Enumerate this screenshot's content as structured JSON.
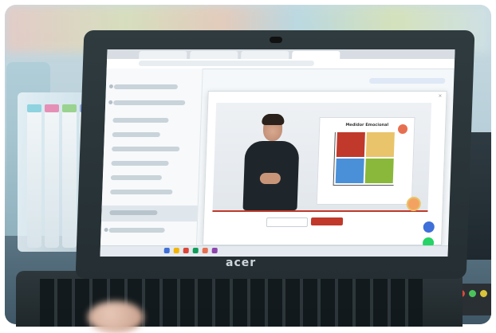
{
  "laptop": {
    "brand": "acer"
  },
  "course_page": {
    "modal": {
      "title": "",
      "slide_title": "Medidor Emocional"
    },
    "quadrant_colors": {
      "top_left": "#c0392b",
      "top_right": "#e9c46a",
      "bottom_left": "#4a90d9",
      "bottom_right": "#8ab83a"
    },
    "accent_color": "#c0392b",
    "icons": [
      "chat-icon",
      "whatsapp-icon"
    ]
  }
}
